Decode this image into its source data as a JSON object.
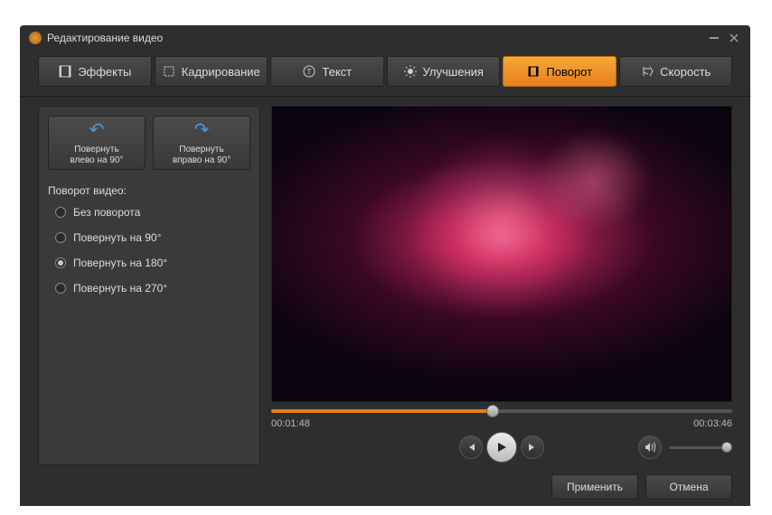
{
  "window": {
    "title": "Редактирование видео"
  },
  "tabs": {
    "effects": "Эффекты",
    "crop": "Кадрирование",
    "text": "Текст",
    "enhance": "Улучшения",
    "rotate": "Поворот",
    "speed": "Скорость"
  },
  "rotate": {
    "left_line1": "Повернуть",
    "left_line2": "влево  на 90°",
    "right_line1": "Повернуть",
    "right_line2": "вправо на 90°",
    "section_label": "Поворот видео:",
    "options": {
      "none": "Без поворота",
      "r90": "Повернуть на 90°",
      "r180": "Повернуть на 180°",
      "r270": "Повернуть на 270°"
    },
    "selected": "r180"
  },
  "player": {
    "current_time": "00:01:48",
    "total_time": "00:03:46",
    "progress_percent": 48
  },
  "footer": {
    "apply": "Применить",
    "cancel": "Отмена"
  }
}
